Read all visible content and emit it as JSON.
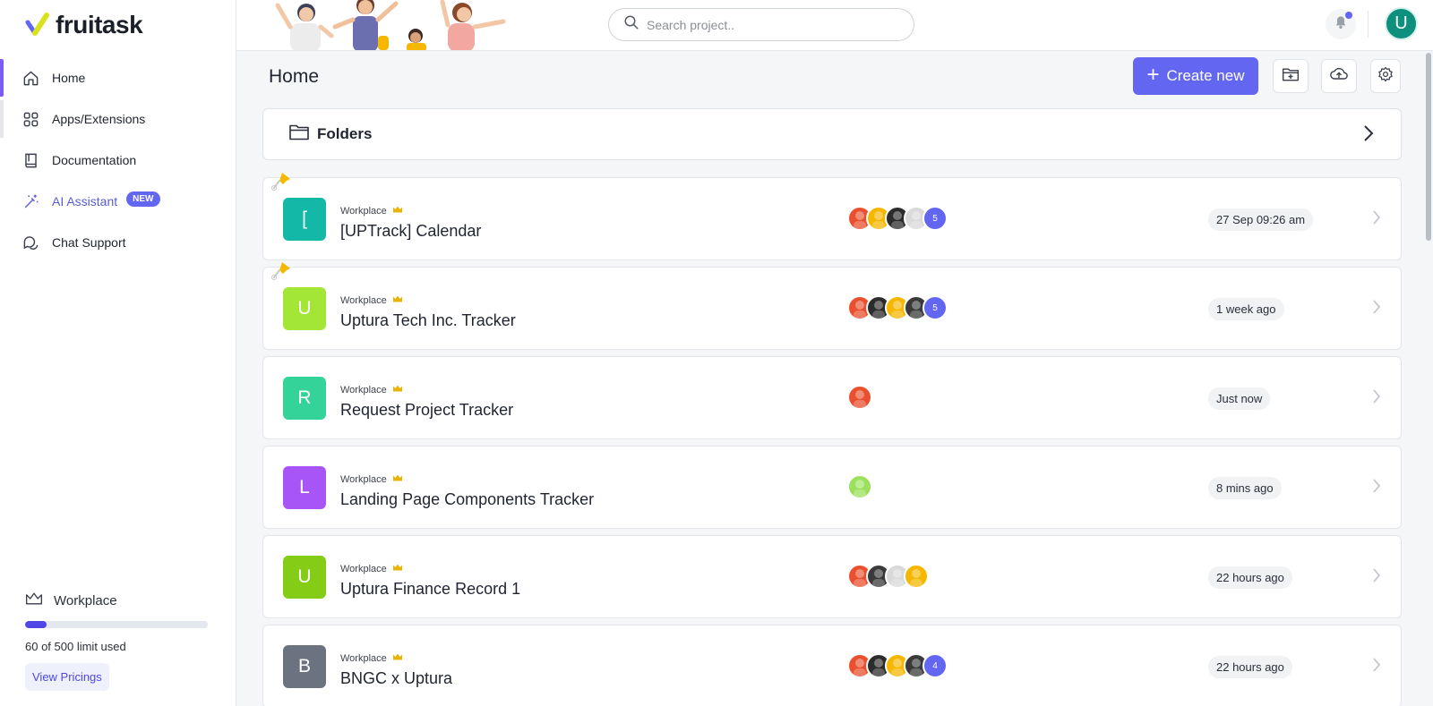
{
  "brand": {
    "name": "fruitask"
  },
  "sidebar": {
    "items": [
      {
        "label": "Home",
        "icon": "home-icon"
      },
      {
        "label": "Apps/Extensions",
        "icon": "grid-icon"
      },
      {
        "label": "Documentation",
        "icon": "book-icon"
      },
      {
        "label": "AI Assistant",
        "icon": "magic-wand-icon",
        "badge": "NEW"
      },
      {
        "label": "Chat Support",
        "icon": "chat-icon"
      }
    ],
    "workspace": {
      "title": "Workplace",
      "limit_text": "60 of 500 limit used",
      "used": 60,
      "limit": 500,
      "pricing_label": "View Pricings"
    }
  },
  "topbar": {
    "search_placeholder": "Search project..",
    "avatar_initial": "U"
  },
  "main": {
    "title": "Home",
    "create_label": "Create new",
    "folders_label": "Folders",
    "projects": [
      {
        "initial": "[",
        "color": "#14b8a6",
        "kicker": "Workplace",
        "name": "[UPTrack] Calendar",
        "extra": "5",
        "time": "27 Sep 09:26 am",
        "pinned": true
      },
      {
        "initial": "U",
        "color": "#a3e635",
        "kicker": "Workplace",
        "name": "Uptura Tech Inc. Tracker",
        "extra": "5",
        "time": "1 week ago",
        "pinned": true
      },
      {
        "initial": "R",
        "color": "#34d399",
        "kicker": "Workplace",
        "name": "Request Project Tracker",
        "extra": "",
        "time": "Just now",
        "pinned": false
      },
      {
        "initial": "L",
        "color": "#a855f7",
        "kicker": "Workplace",
        "name": "Landing Page Components Tracker",
        "extra": "",
        "time": "8 mins ago",
        "pinned": false
      },
      {
        "initial": "U",
        "color": "#84cc16",
        "kicker": "Workplace",
        "name": "Uptura Finance Record 1",
        "extra": "",
        "time": "22 hours ago",
        "pinned": false
      },
      {
        "initial": "B",
        "color": "#6b7280",
        "kicker": "Workplace",
        "name": "BNGC x Uptura",
        "extra": "4",
        "time": "22 hours ago",
        "pinned": false
      }
    ]
  },
  "colors": {
    "accent": "#6366f1",
    "active_bar": "#7c5cf5",
    "crown": "#eab308"
  }
}
